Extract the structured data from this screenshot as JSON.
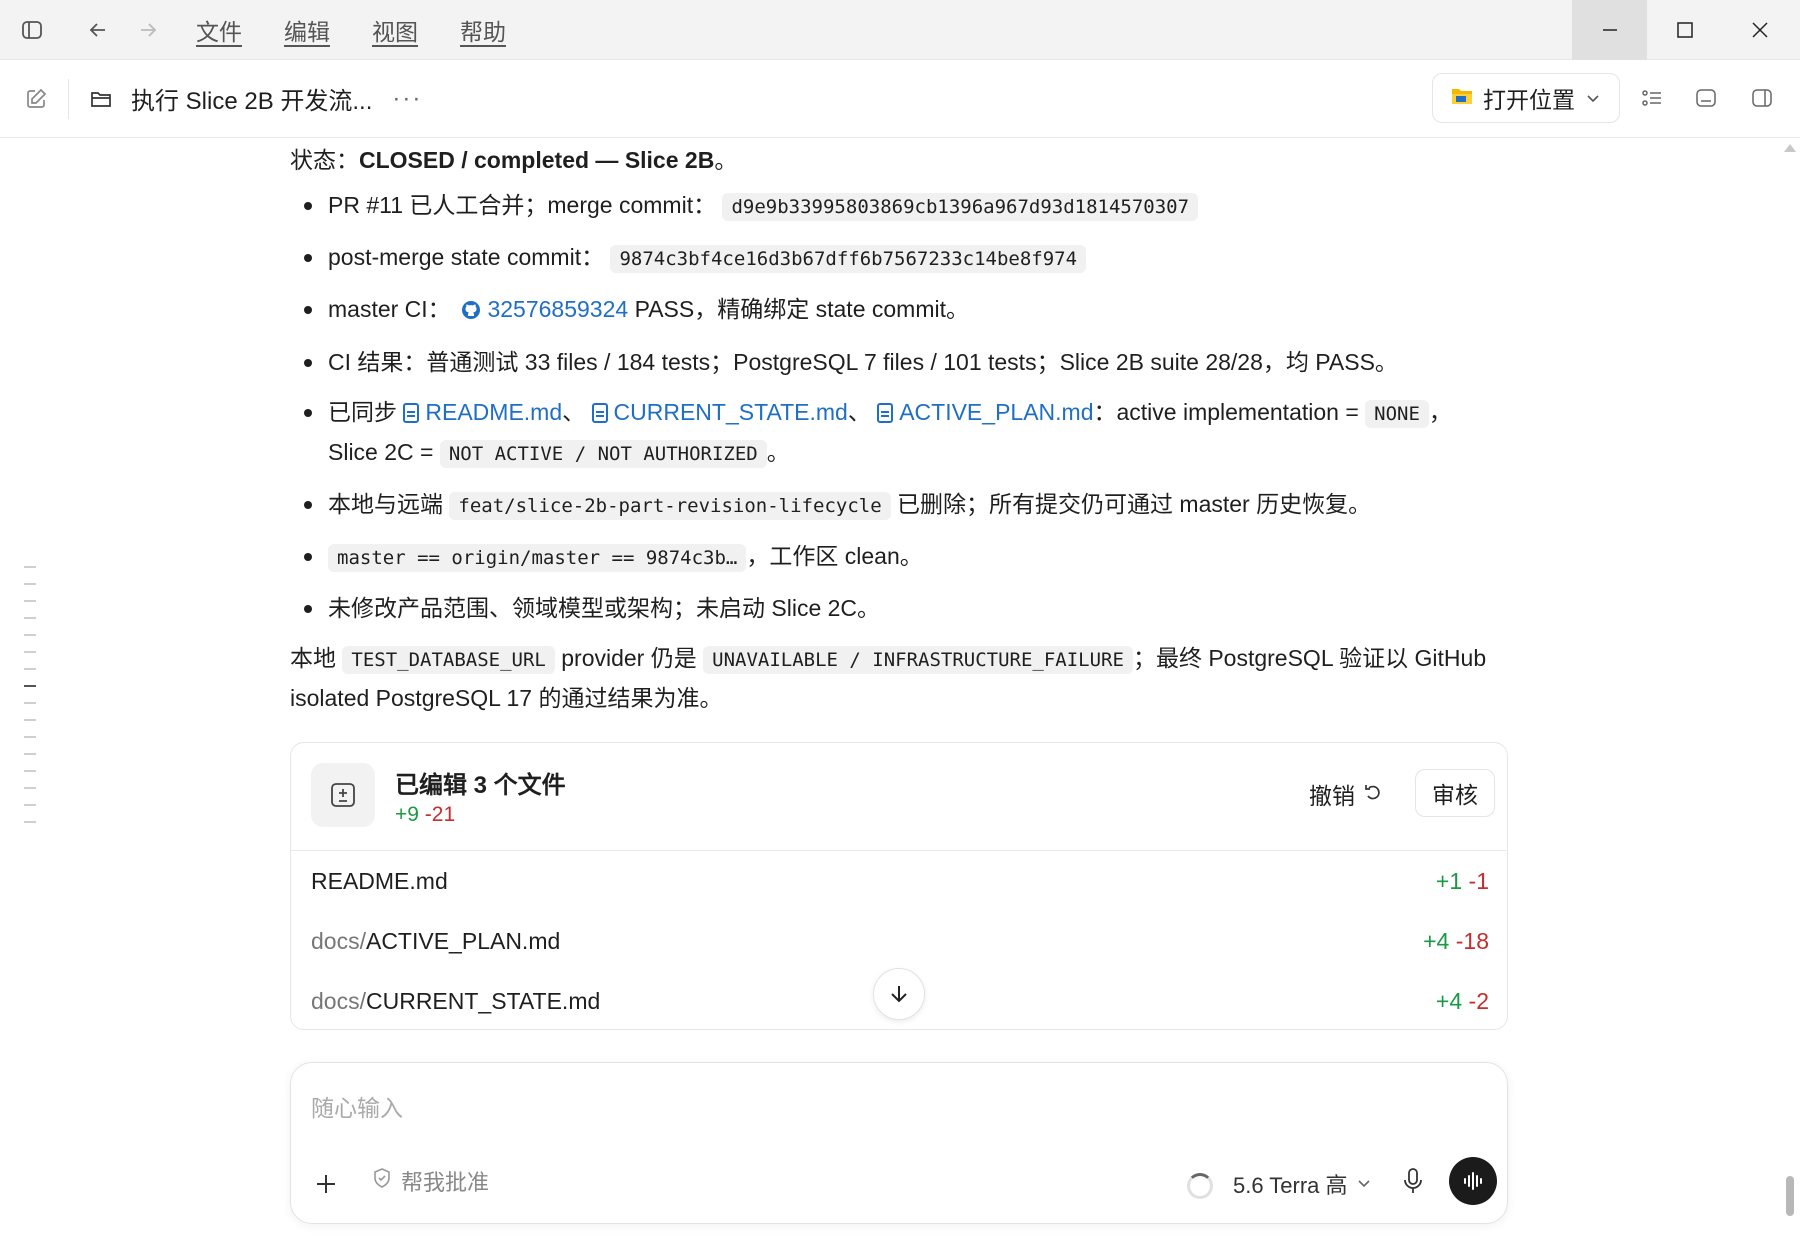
{
  "menu": [
    "文件",
    "编辑",
    "视图",
    "帮助"
  ],
  "toolbar": {
    "thread_title": "执行 Slice 2B 开发流...",
    "more": "···",
    "open_location": "打开位置"
  },
  "status": {
    "prefix": "状态：",
    "value": "CLOSED / completed — Slice 2B",
    "suffix": "。"
  },
  "bullets": {
    "b1": {
      "text": "PR #11 已人工合并；merge commit：",
      "code": "d9e9b33995803869cb1396a967d93d1814570307"
    },
    "b2": {
      "text": "post-merge state commit：",
      "code": "9874c3bf4ce16d3b67dff6b7567233c14be8f974"
    },
    "b3": {
      "text": "master CI：",
      "link": "32576859324",
      "after": " PASS，精确绑定 state commit。"
    },
    "b4": {
      "text": "CI 结果：普通测试 33 files / 184 tests；PostgreSQL 7 files / 101 tests；Slice 2B suite 28/28，均 PASS。"
    },
    "b5": {
      "text": "已同步 ",
      "link1": "README.md",
      "sep1": "、",
      "link2": "CURRENT_STATE.md",
      "sep2": "、",
      "link3": "ACTIVE_PLAN.md",
      "mid": "：active implementation = ",
      "code1": "NONE",
      "mid2": "，",
      "line2": "Slice 2C = ",
      "code2": "NOT ACTIVE / NOT AUTHORIZED",
      "end": "。"
    },
    "b6": {
      "text": "本地与远端 ",
      "code": "feat/slice-2b-part-revision-lifecycle",
      "after": " 已删除；所有提交仍可通过 master 历史恢复。"
    },
    "b7": {
      "code": "master == origin/master == 9874c3b…",
      "after": "，工作区 clean。"
    },
    "b8": {
      "text": "未修改产品范围、领域模型或架构；未启动 Slice 2C。"
    }
  },
  "note": {
    "pre": "本地 ",
    "code1": "TEST_DATABASE_URL",
    "mid": " provider 仍是 ",
    "code2": "UNAVAILABLE / INFRASTRUCTURE_FAILURE",
    "post": "；最终 PostgreSQL 验证以 GitHub isolated PostgreSQL 17 的通过结果为准。"
  },
  "edited": {
    "title": "已编辑 3 个文件",
    "plus": "+9",
    "minus": "-21",
    "undo": "撤销",
    "review": "审核",
    "files": [
      {
        "dir": "",
        "name": "README.md",
        "plus": "+1",
        "minus": "-1"
      },
      {
        "dir": "docs/",
        "name": "ACTIVE_PLAN.md",
        "plus": "+4",
        "minus": "-18"
      },
      {
        "dir": "docs/",
        "name": "CURRENT_STATE.md",
        "plus": "+4",
        "minus": "-2"
      }
    ]
  },
  "composer": {
    "placeholder": "随心输入",
    "approve": "帮我批准",
    "model": "5.6 Terra 高"
  },
  "colors": {
    "link": "#1f6fc5",
    "plus": "#1a9a44",
    "minus": "#c62d2d"
  }
}
